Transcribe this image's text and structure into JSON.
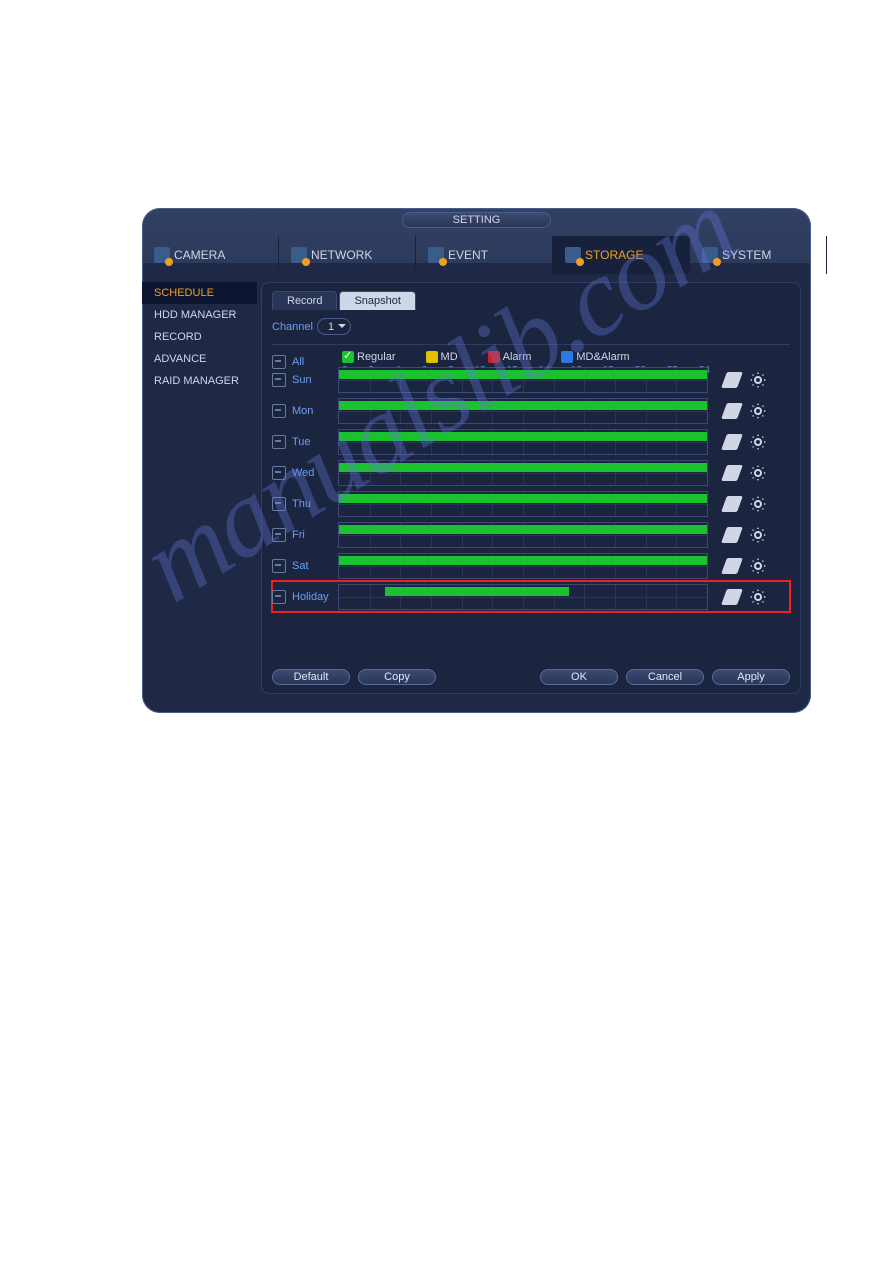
{
  "window_title": "SETTING",
  "topnav": [
    {
      "label": "CAMERA",
      "active": false
    },
    {
      "label": "NETWORK",
      "active": false
    },
    {
      "label": "EVENT",
      "active": false
    },
    {
      "label": "STORAGE",
      "active": true
    },
    {
      "label": "SYSTEM",
      "active": false
    }
  ],
  "sidebar": [
    {
      "label": "SCHEDULE",
      "active": true
    },
    {
      "label": "HDD MANAGER",
      "active": false
    },
    {
      "label": "RECORD",
      "active": false
    },
    {
      "label": "ADVANCE",
      "active": false
    },
    {
      "label": "RAID MANAGER",
      "active": false
    }
  ],
  "subtabs": [
    {
      "label": "Record",
      "active": false
    },
    {
      "label": "Snapshot",
      "active": true
    }
  ],
  "channel_label": "Channel",
  "channel_value": "1",
  "legend": {
    "regular": "Regular",
    "md": "MD",
    "alarm": "Alarm",
    "mdalarm": "MD&Alarm"
  },
  "hour_ticks": [
    "0",
    "2",
    "4",
    "6",
    "8",
    "10",
    "12",
    "14",
    "16",
    "18",
    "20",
    "22",
    "24"
  ],
  "days": [
    {
      "name": "All",
      "is_header": true,
      "highlight": false,
      "regular": null
    },
    {
      "name": "Sun",
      "is_header": false,
      "highlight": false,
      "regular": [
        0,
        24
      ]
    },
    {
      "name": "Mon",
      "is_header": false,
      "highlight": false,
      "regular": [
        0,
        24
      ]
    },
    {
      "name": "Tue",
      "is_header": false,
      "highlight": false,
      "regular": [
        0,
        24
      ]
    },
    {
      "name": "Wed",
      "is_header": false,
      "highlight": false,
      "regular": [
        0,
        24
      ]
    },
    {
      "name": "Thu",
      "is_header": false,
      "highlight": false,
      "regular": [
        0,
        24
      ]
    },
    {
      "name": "Fri",
      "is_header": false,
      "highlight": false,
      "regular": [
        0,
        24
      ]
    },
    {
      "name": "Sat",
      "is_header": false,
      "highlight": false,
      "regular": [
        0,
        24
      ]
    },
    {
      "name": "Holiday",
      "is_header": false,
      "highlight": true,
      "regular": [
        3,
        15
      ]
    }
  ],
  "buttons": {
    "default": "Default",
    "copy": "Copy",
    "ok": "OK",
    "cancel": "Cancel",
    "apply": "Apply"
  },
  "watermark": "manualslib.com"
}
